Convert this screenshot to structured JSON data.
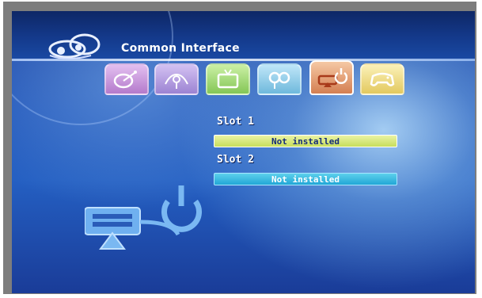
{
  "menu": {
    "title": "Common Interface"
  },
  "tabs": [
    {
      "icon": "satellite-icon",
      "color": "#c890d8",
      "selected": false
    },
    {
      "icon": "antenna-search-icon",
      "color": "#b8a0e0",
      "selected": false
    },
    {
      "icon": "tv-icon",
      "color": "#a8e07a",
      "selected": false
    },
    {
      "icon": "parental-users-icon",
      "color": "#8fd0f0",
      "selected": false
    },
    {
      "icon": "common-interface-icon",
      "color": "#e8a070",
      "selected": true
    },
    {
      "icon": "gamepad-icon",
      "color": "#f0e08a",
      "selected": false
    }
  ],
  "slots": [
    {
      "label": "Slot 1",
      "status": "Not installed",
      "highlighted": true
    },
    {
      "label": "Slot 2",
      "status": "Not installed",
      "highlighted": false
    }
  ],
  "colors": {
    "highlight": "#d4e66a",
    "normal_bar": "#2fb4df",
    "background": "#1d52b8"
  }
}
